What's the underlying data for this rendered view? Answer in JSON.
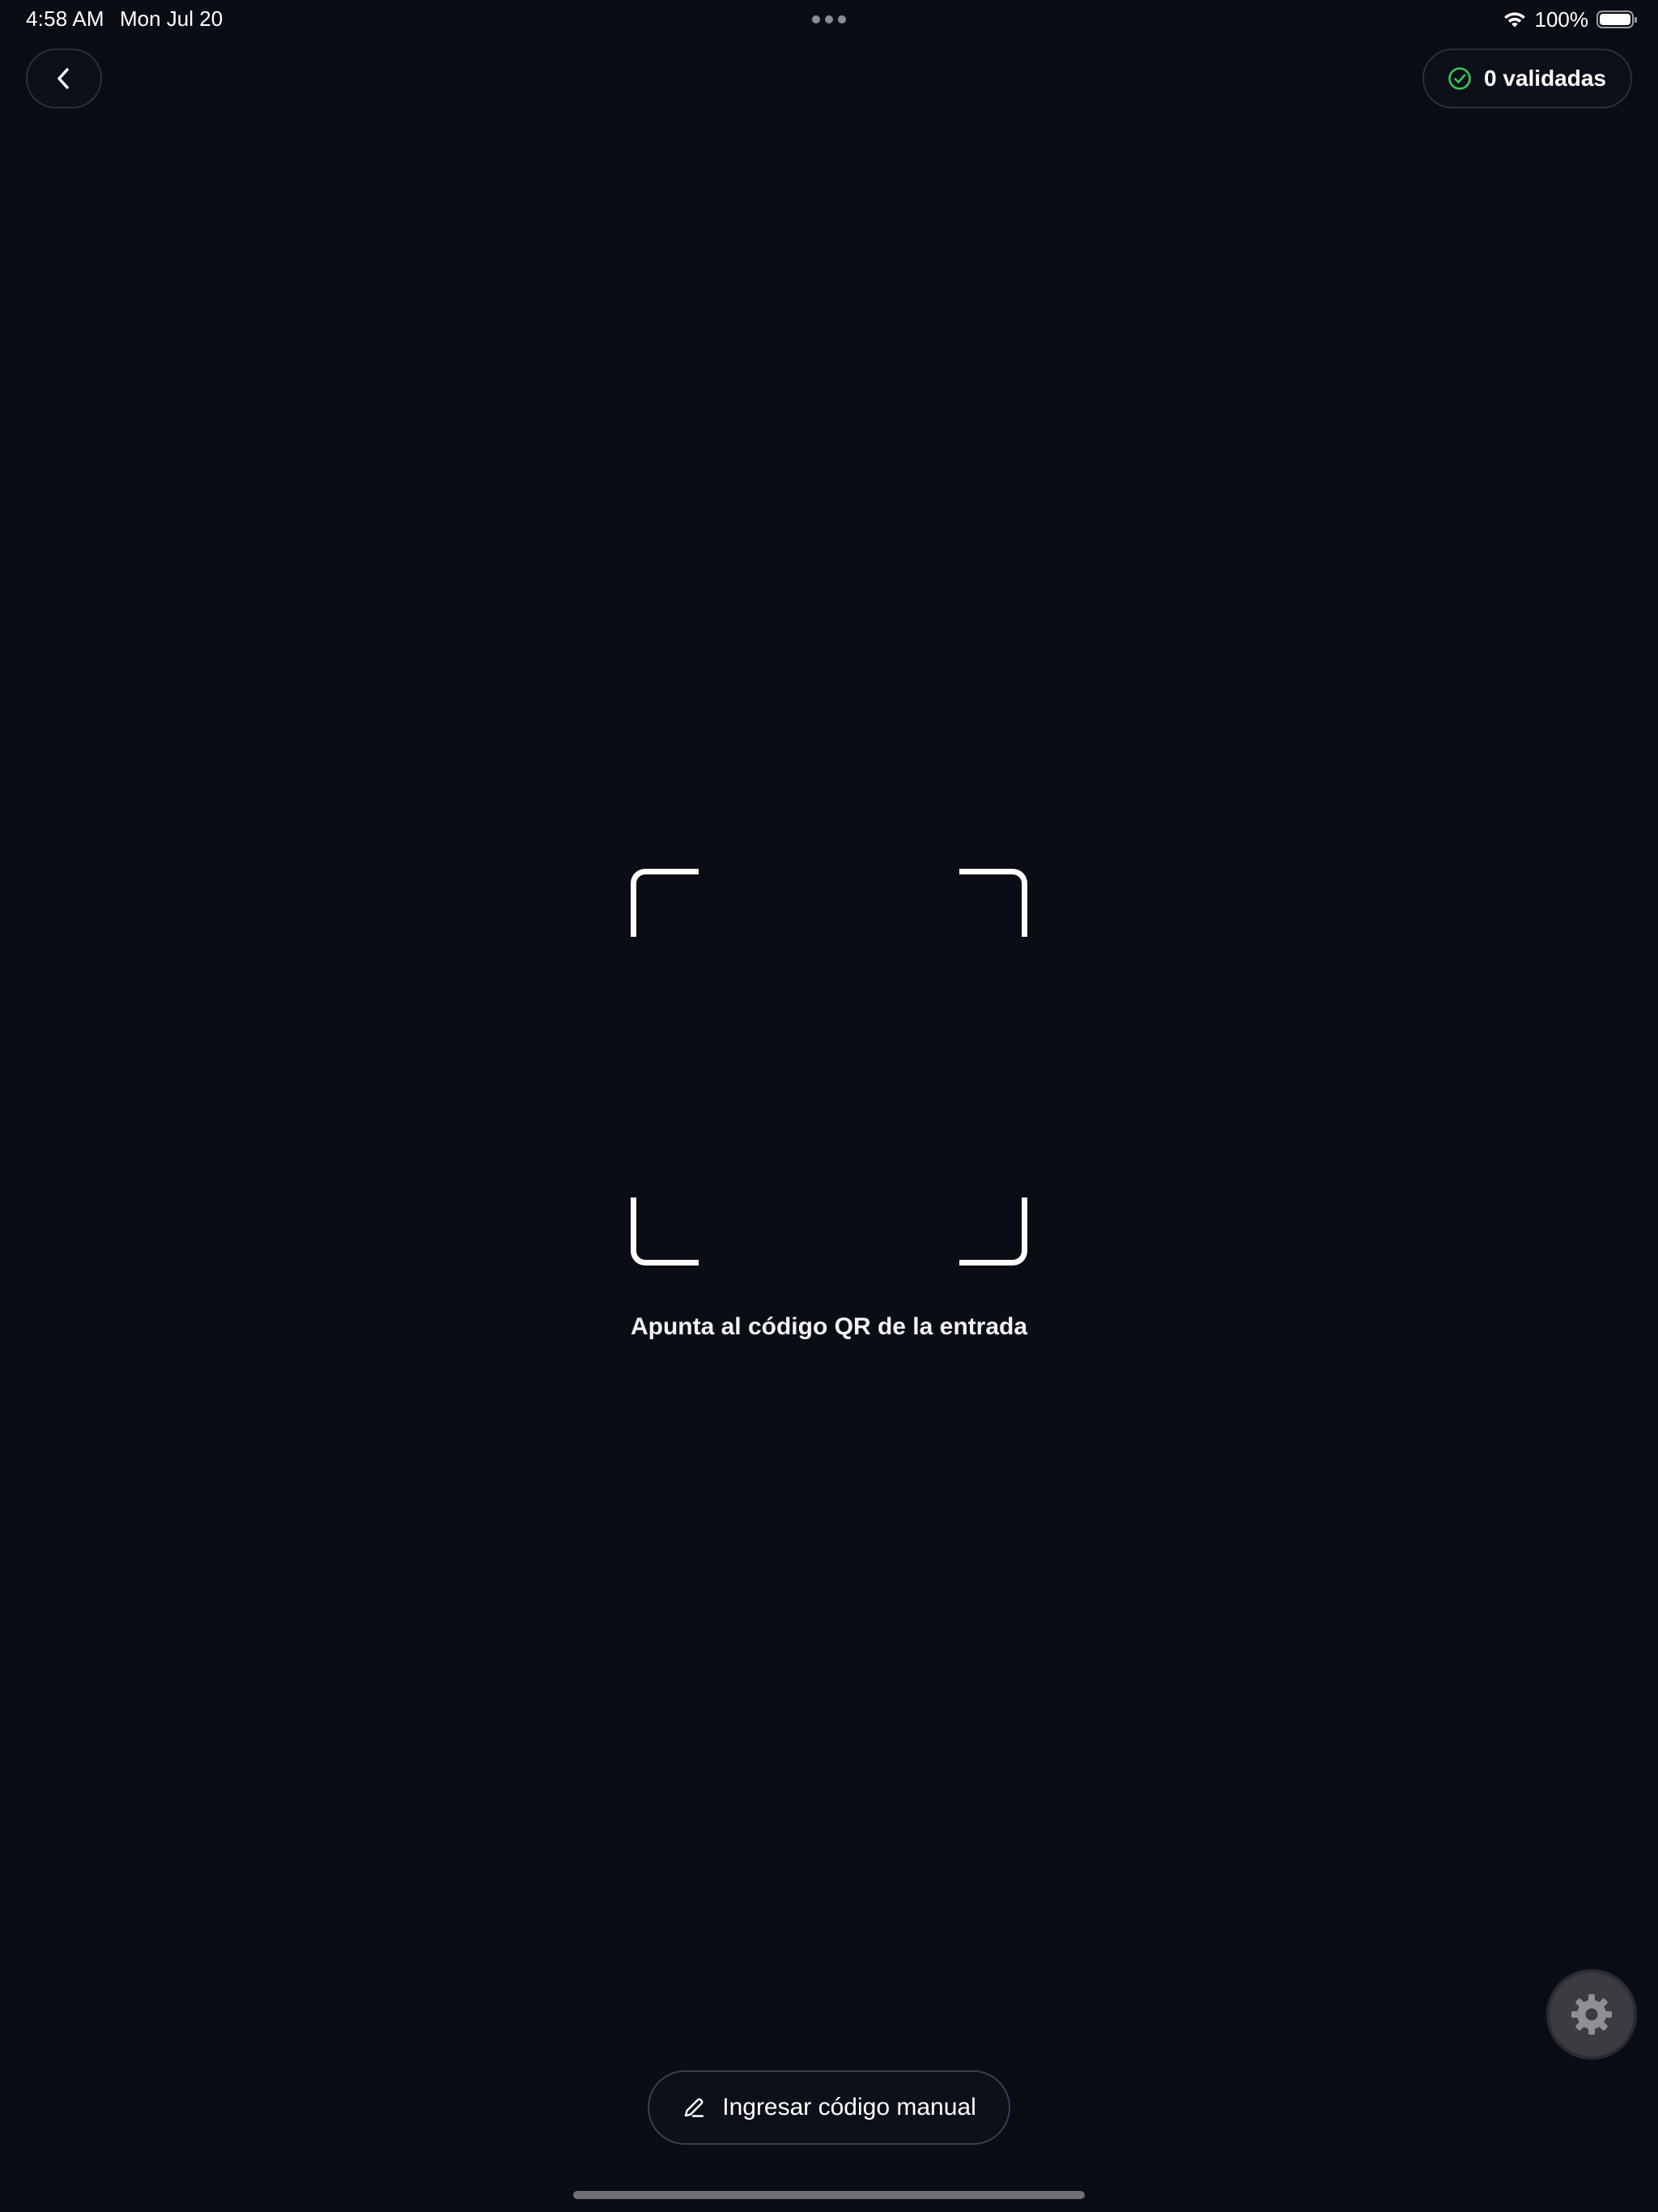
{
  "status_bar": {
    "time": "4:58 AM",
    "date": "Mon Jul 20",
    "battery": "100%",
    "battery_level": 1.0
  },
  "header": {
    "back_icon": "chevron-left-icon",
    "validated_icon": "check-circle-icon",
    "validated_label": "0 validadas"
  },
  "scanner": {
    "hint": "Apunta al código QR de la entrada"
  },
  "actions": {
    "manual_icon": "pencil-icon",
    "manual_label": "Ingresar código manual",
    "settings_icon": "gear-icon"
  },
  "colors": {
    "background": "#0a0d14",
    "accent_green": "#34c759",
    "frame": "#ffffff"
  }
}
